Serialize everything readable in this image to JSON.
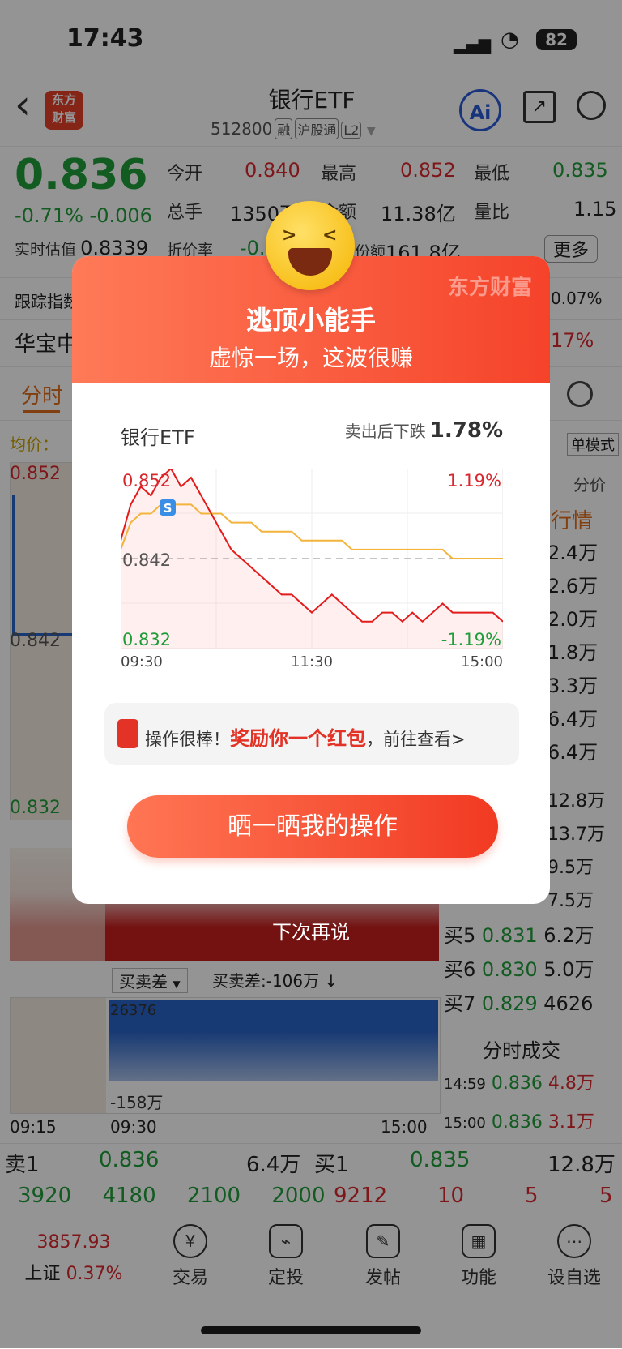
{
  "status_bar": {
    "time": "17:43",
    "battery": "82"
  },
  "header": {
    "back": "‹",
    "logo_line1": "东方",
    "logo_line2": "财富",
    "title": "银行ETF",
    "code": "512800",
    "tags": [
      "融",
      "沪股通",
      "L2"
    ],
    "ai_label": "Ai"
  },
  "quote": {
    "price": "0.836",
    "change_pct": "-0.71%",
    "change": "-0.006",
    "est_label": "实时估值",
    "est_value": "0.8339",
    "premium_label": "折价率",
    "premium_value": "-0.",
    "fields": [
      {
        "label": "今开",
        "value": "0.840"
      },
      {
        "label": "最高",
        "value": "0.852"
      },
      {
        "label": "最低",
        "value": "0.835"
      },
      {
        "label": "总手",
        "value": "1350万"
      },
      {
        "label": "金额",
        "value": "11.38亿"
      },
      {
        "label": "量比",
        "value": "1.15"
      }
    ],
    "share_label": "份额",
    "share_value": "161.8亿",
    "more_button": "更多",
    "track_label": "跟踪指数",
    "track_value": "0.07%",
    "fund_label": "华宝中",
    "fund_value": "17%"
  },
  "tabs": {
    "active": "分时",
    "mode": "单模式"
  },
  "chart_side": {
    "avg_label": "均价：",
    "price_top": "0.852",
    "price_mid": "0.842",
    "price_low": "0.832",
    "diff_select": "买卖差",
    "diff_text": "买卖差:-106万 ↓",
    "flow_top": "26376",
    "flow_low": "-158万",
    "time_start": "09:15",
    "time_open": "09:30",
    "time_close": "15:00"
  },
  "order_side": {
    "price_label": "分价",
    "market_label": "行情",
    "asks": [
      "2.4万",
      "2.6万",
      "2.0万",
      "1.8万",
      "3.3万",
      "6.4万",
      "6.4万"
    ],
    "bids_top": [
      "12.8万",
      "13.7万",
      "9.5万",
      "7.5万"
    ],
    "bids": [
      {
        "label": "买5",
        "price": "0.831",
        "vol": "6.2万"
      },
      {
        "label": "买6",
        "price": "0.830",
        "vol": "5.0万"
      },
      {
        "label": "买7",
        "price": "0.829",
        "vol": "4626"
      }
    ],
    "ticks_title": "分时成交",
    "ticks": [
      {
        "time": "14:59",
        "price": "0.836",
        "vol": "4.8万"
      },
      {
        "time": "15:00",
        "price": "0.836",
        "vol": "3.1万"
      }
    ]
  },
  "book": {
    "sell1_label": "卖1",
    "sell1_price": "0.836",
    "sell1_vol": "6.4万",
    "buy1_label": "买1",
    "buy1_price": "0.835",
    "buy1_vol": "12.8万",
    "left_nums": [
      "3920",
      "4180",
      "2100",
      "2000"
    ],
    "right_nums": [
      "9212",
      "10",
      "5",
      "5"
    ]
  },
  "bottom_nav": {
    "index_value": "3857.93",
    "index_name": "上证",
    "index_change": "0.37%",
    "items": [
      "交易",
      "定投",
      "发帖",
      "功能",
      "设自选"
    ]
  },
  "modal": {
    "watermark": "东方财富",
    "title": "逃顶小能手",
    "subtitle": "虚惊一场，这波很赚",
    "stock": "银行ETF",
    "drop_label": "卖出后下跌",
    "drop_value": "1.78%",
    "badge": "S",
    "reward_prefix": "操作很棒！",
    "reward_highlight": "奖励你一个红包",
    "reward_suffix": "，前往查看>",
    "share_button": "晒一晒我的操作",
    "dismiss": "下次再说",
    "colors": {
      "accent": "#f5432a",
      "price_line": "#e41b1b",
      "avg_line": "#f3b43c"
    }
  },
  "chart_data": {
    "type": "line",
    "x_ticks": [
      "09:30",
      "11:30",
      "15:00"
    ],
    "y_ticks_left": [
      "0.852",
      "0.842",
      "0.832"
    ],
    "y_ticks_right": [
      "1.19%",
      "-1.19%"
    ],
    "ylim": [
      0.832,
      0.852
    ],
    "reference": 0.842,
    "series": [
      {
        "values": [
          0.844,
          0.848,
          0.85,
          0.849,
          0.851,
          0.852,
          0.85,
          0.851,
          0.849,
          0.847,
          0.845,
          0.843,
          0.842,
          0.841,
          0.84,
          0.839,
          0.838,
          0.838,
          0.837,
          0.836,
          0.837,
          0.838,
          0.837,
          0.836,
          0.835,
          0.835,
          0.836,
          0.836,
          0.835,
          0.836,
          0.835,
          0.836,
          0.837,
          0.836,
          0.836,
          0.836,
          0.836,
          0.836,
          0.835
        ]
      },
      {
        "values": [
          0.843,
          0.846,
          0.847,
          0.847,
          0.848,
          0.848,
          0.848,
          0.848,
          0.847,
          0.847,
          0.847,
          0.846,
          0.846,
          0.846,
          0.845,
          0.845,
          0.845,
          0.845,
          0.844,
          0.844,
          0.844,
          0.844,
          0.844,
          0.843,
          0.843,
          0.843,
          0.843,
          0.843,
          0.843,
          0.843,
          0.843,
          0.843,
          0.843,
          0.842,
          0.842,
          0.842,
          0.842,
          0.842,
          0.842
        ]
      }
    ]
  }
}
